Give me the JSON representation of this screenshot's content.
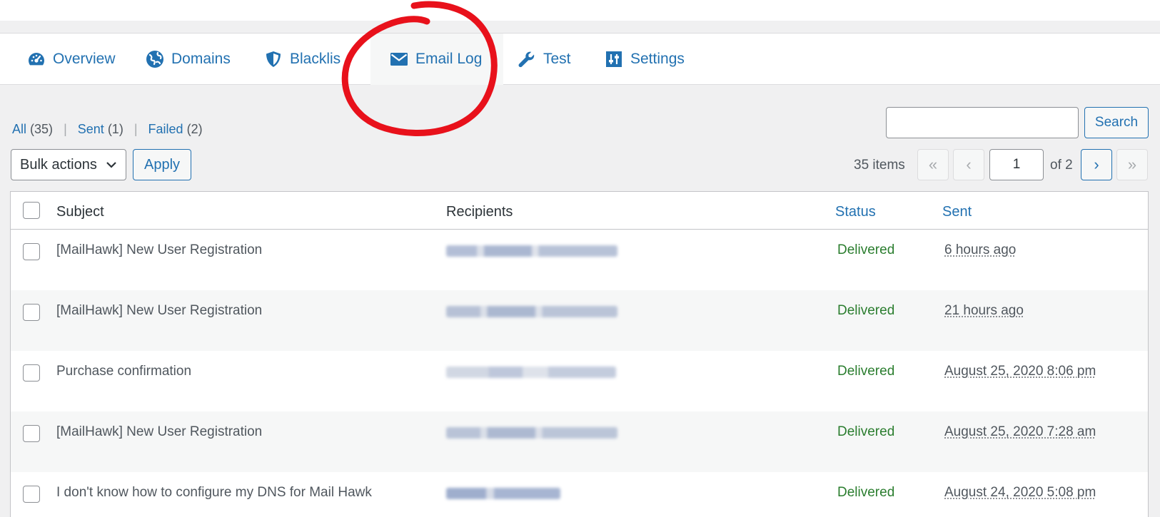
{
  "tabs": [
    {
      "label": "Overview",
      "icon": "dashboard-icon"
    },
    {
      "label": "Domains",
      "icon": "globe-icon"
    },
    {
      "label": "Blacklis",
      "icon": "shield-icon"
    },
    {
      "label": "Email Log",
      "icon": "envelope-icon"
    },
    {
      "label": "Test",
      "icon": "wrench-icon"
    },
    {
      "label": "Settings",
      "icon": "sliders-icon"
    }
  ],
  "filters": {
    "all": {
      "label": "All",
      "count": "(35)"
    },
    "sent": {
      "label": "Sent",
      "count": "(1)"
    },
    "failed": {
      "label": "Failed",
      "count": "(2)"
    },
    "separator": "|"
  },
  "search": {
    "button": "Search",
    "value": ""
  },
  "bulk": {
    "selected": "Bulk actions",
    "apply": "Apply"
  },
  "pagination": {
    "items": "35 items",
    "first": "«",
    "prev": "‹",
    "current": "1",
    "of": "of 2",
    "next": "›",
    "last": "»"
  },
  "table": {
    "headers": {
      "subject": "Subject",
      "recipients": "Recipients",
      "status": "Status",
      "sent": "Sent"
    },
    "rows": [
      {
        "subject": "[MailHawk] New User Registration",
        "status": "Delivered",
        "sent": "6 hours ago"
      },
      {
        "subject": "[MailHawk] New User Registration",
        "status": "Delivered",
        "sent": "21 hours ago"
      },
      {
        "subject": "Purchase confirmation",
        "status": "Delivered",
        "sent": "August 25, 2020 8:06 pm"
      },
      {
        "subject": "[MailHawk] New User Registration",
        "status": "Delivered",
        "sent": "August 25, 2020 7:28 am"
      },
      {
        "subject": "I don't know how to configure my DNS for Mail Hawk",
        "status": "Delivered",
        "sent": "August 24, 2020 5:08 pm"
      }
    ]
  },
  "colors": {
    "link": "#2271b1",
    "delivered": "#2a7d2e",
    "annotation": "#e8111b",
    "background": "#f0f0f1"
  }
}
